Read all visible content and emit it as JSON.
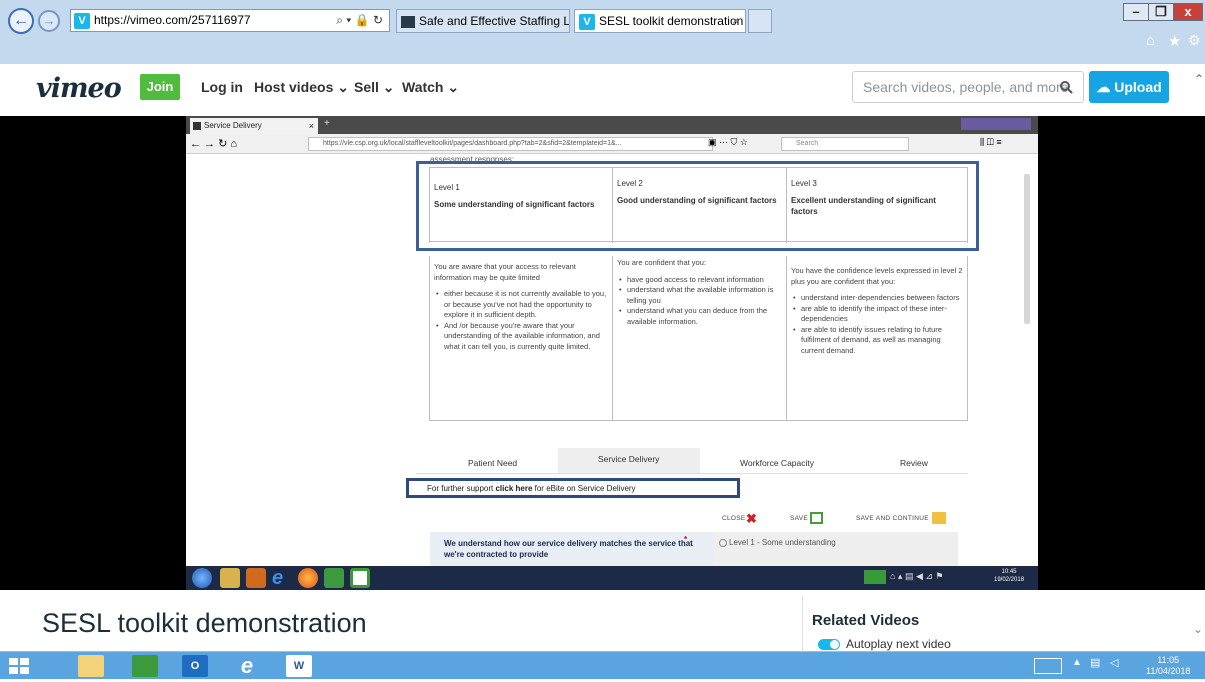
{
  "browser": {
    "url": "https://vimeo.com/257116977",
    "tabs": [
      {
        "label": "Safe and Effective Staffing Lev..."
      },
      {
        "label": "SESL toolkit demonstration ...",
        "close": "×"
      }
    ],
    "window_buttons": {
      "minimize": "–",
      "maximize": "❐",
      "close": "x"
    },
    "toolbar_icons": {
      "home": "⌂",
      "favorites": "★",
      "settings": "⚙"
    },
    "nav": {
      "back": "←",
      "forward": "→"
    },
    "addr_tools": "⌕ ▾ 🔒 ↻"
  },
  "vimeo": {
    "logo": "vimeo",
    "join": "Join",
    "login": "Log in",
    "host_videos": "Host videos",
    "sell": "Sell",
    "watch": "Watch",
    "search_placeholder": "Search videos, people, and more",
    "upload": "Upload",
    "accent_color": "#17a4e3",
    "join_color": "#4fbc3b"
  },
  "video": {
    "ff_tab_title": "Service Delivery",
    "ff_url": "https://vle.csp.org.uk/local/staffleveltoolkit/pages/dashboard.php?tab=2&sfid=2&templateid=1&...",
    "ff_search": "Search",
    "header_text": "assessment responses:",
    "levels": [
      {
        "name": "Level 1",
        "desc": "Some understanding of significant factors"
      },
      {
        "name": "Level 2",
        "desc": "Good understanding of significant factors"
      },
      {
        "name": "Level 3",
        "desc": "Excellent understanding of significant factors"
      }
    ],
    "level1_intro": "You are aware that your access to relevant information may be quite limited",
    "level1_bullets": [
      "either because it is not currently available to you, or because you've not had the opportunity to explore it in sufficient depth.",
      "And /or because you're aware that your understanding of the available information, and what it can tell you, is currently quite limited."
    ],
    "level2_intro": "You are confident that you:",
    "level2_bullets": [
      "have good access to relevant information",
      "understand what the available information is telling you",
      "understand what you can deduce from the available information."
    ],
    "level3_intro": "You have the confidence levels expressed in level 2 plus you are confident that you:",
    "level3_bullets": [
      "understand inter-dependencies between factors",
      "are able to identify the impact of these inter-dependencies",
      "are able to identify issues relating to future fulfilment of demand, as well as managing current demand."
    ],
    "tabs": [
      "Patient Need",
      "Service Delivery",
      "Workforce Capacity",
      "Review"
    ],
    "support_prefix": "For further support ",
    "support_link": "click here",
    "support_suffix": " for eBite on Service Delivery",
    "close": "CLOSE",
    "save": "SAVE",
    "save_continue": "SAVE AND CONTINUE",
    "question": "We understand how our service delivery matches the service that we're contracted to provide",
    "required_mark": "*",
    "option1": "Level 1 - Some understanding",
    "clock_time": "10:45",
    "clock_date": "19/02/2018"
  },
  "page": {
    "title": "SESL toolkit demonstration",
    "related": "Related Videos",
    "autoplay": "Autoplay next video"
  },
  "taskbar": {
    "time": "11:05",
    "date": "11/04/2018",
    "tray_up": "▲"
  }
}
